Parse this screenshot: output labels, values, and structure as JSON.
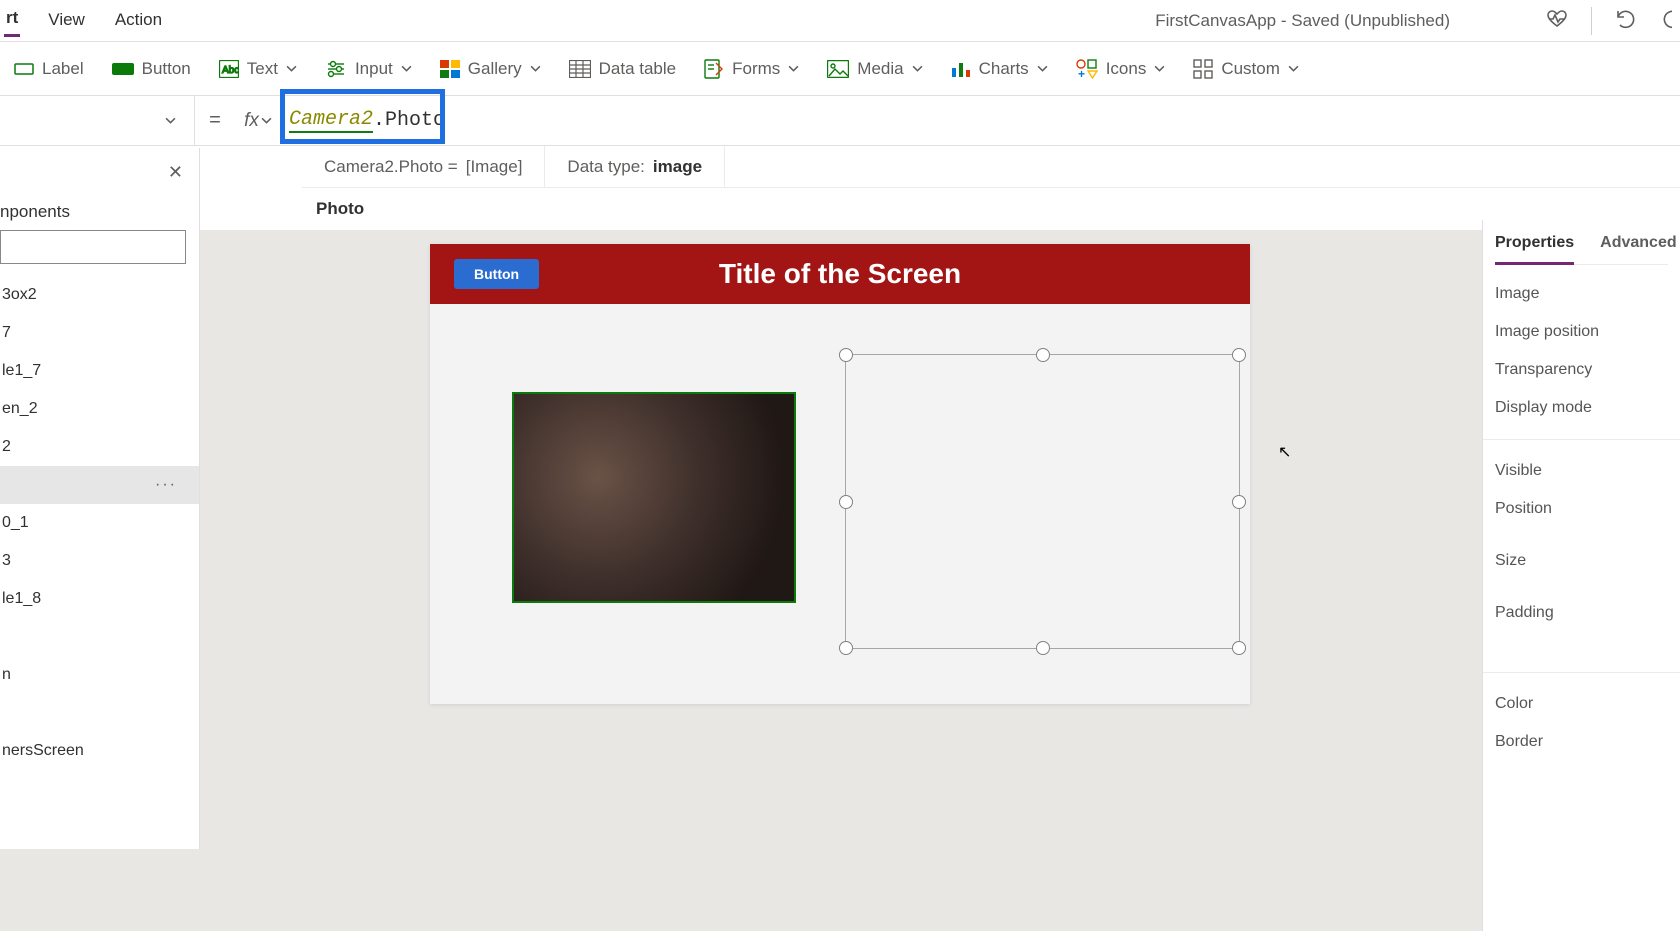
{
  "menubar": {
    "items": [
      "rt",
      "View",
      "Action"
    ],
    "doc_title": "FirstCanvasApp - Saved (Unpublished)"
  },
  "ribbon": {
    "label_btn": "Label",
    "button_btn": "Button",
    "text_menu": "Text",
    "input_menu": "Input",
    "gallery_menu": "Gallery",
    "data_table": "Data table",
    "forms_menu": "Forms",
    "media_menu": "Media",
    "charts_menu": "Charts",
    "icons_menu": "Icons",
    "custom_menu": "Custom"
  },
  "formula": {
    "equals": "=",
    "fx": "fx",
    "object": "Camera2",
    "dot": ".",
    "property": "Photo",
    "result_lhs": "Camera2.Photo  =",
    "result_rhs": "[Image]",
    "datatype_label": "Data type:",
    "datatype_value": "image"
  },
  "selected_element": "Photo",
  "tree": {
    "section": "nponents",
    "items": [
      "3ox2",
      "7",
      "le1_7",
      "en_2",
      "2",
      "",
      "0_1",
      "3",
      "le1_8",
      "",
      "n",
      "",
      "nersScreen"
    ],
    "selected_index": 5
  },
  "canvas": {
    "button_label": "Button",
    "title": "Title of the Screen"
  },
  "right_panel": {
    "tabs": {
      "properties": "Properties",
      "advanced": "Advanced"
    },
    "group1": [
      "Image",
      "Image position",
      "Transparency",
      "Display mode"
    ],
    "group2": [
      "Visible",
      "Position",
      "Size",
      "Padding"
    ],
    "group3": [
      "Color",
      "Border"
    ]
  }
}
